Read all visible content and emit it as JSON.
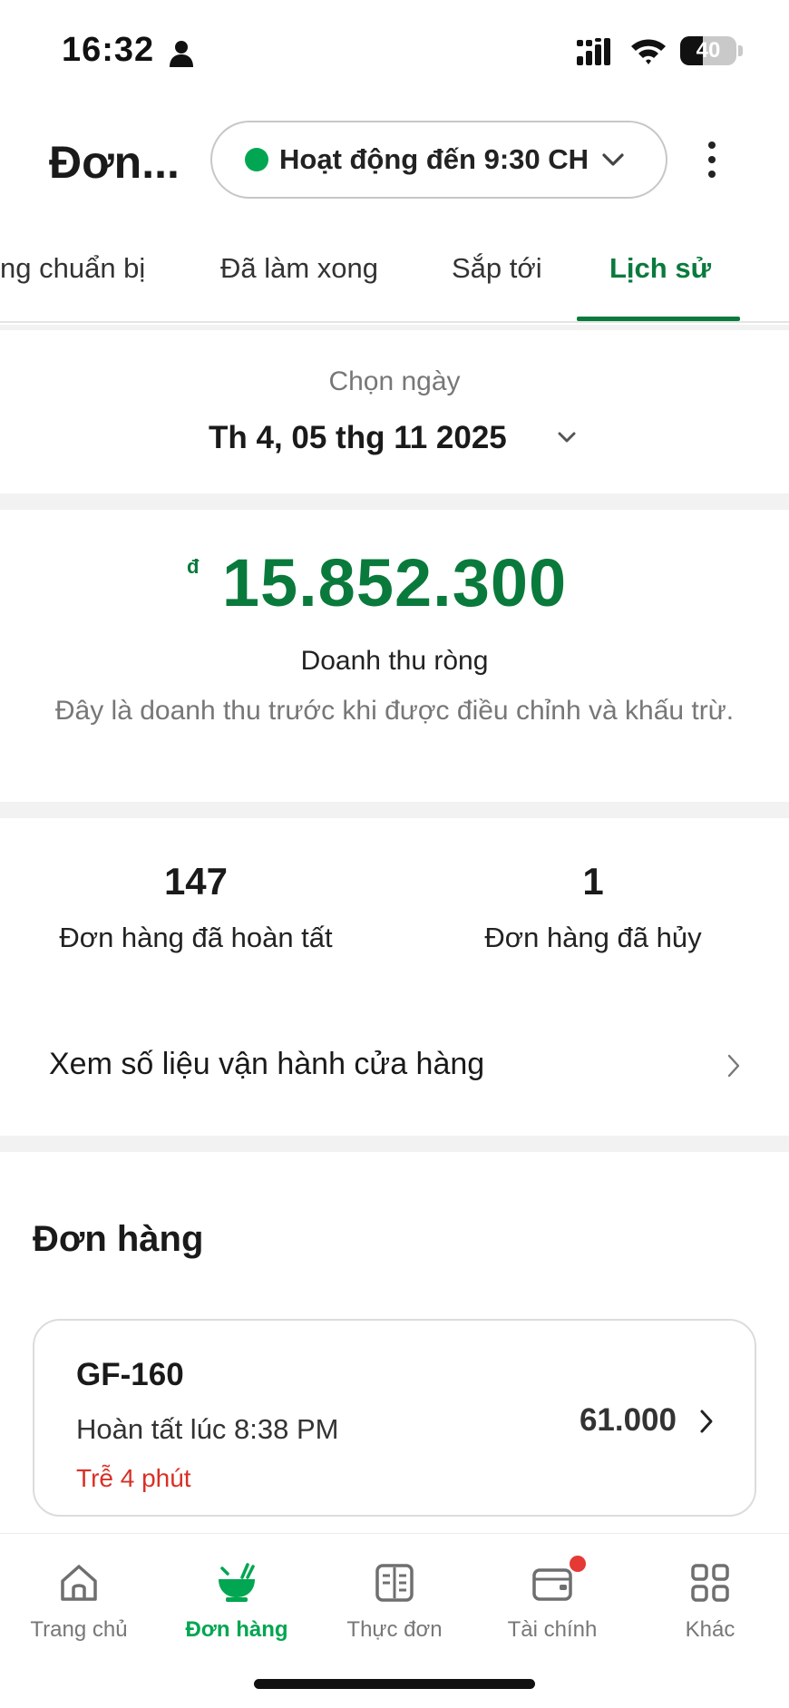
{
  "status_bar": {
    "time": "16:32",
    "battery_level": "40",
    "icons": [
      "person-icon",
      "signal-icon",
      "wifi-icon",
      "battery-icon"
    ]
  },
  "header": {
    "title": "Đơn...",
    "status_text": "Hoạt động đến 9:30 CH",
    "status_color": "#00a651"
  },
  "tabs": [
    {
      "label": "ng chuẩn bị",
      "active": false
    },
    {
      "label": "Đã làm xong",
      "active": false
    },
    {
      "label": "Sắp tới",
      "active": false
    },
    {
      "label": "Lịch sử",
      "active": true
    }
  ],
  "date_picker": {
    "label": "Chọn ngày",
    "value": "Th 4, 05 thg 11 2025"
  },
  "revenue": {
    "currency": "đ",
    "amount": "15.852.300",
    "label": "Doanh thu ròng",
    "description": "Đây là doanh thu trước khi được điều chỉnh và khấu trừ."
  },
  "stats": {
    "completed_count": "147",
    "completed_label": "Đơn hàng đã hoàn tất",
    "cancelled_count": "1",
    "cancelled_label": "Đơn hàng đã hủy"
  },
  "ops_link": {
    "label": "Xem số liệu vận hành cửa hàng"
  },
  "orders": {
    "heading": "Đơn hàng",
    "items": [
      {
        "id": "GF-160",
        "completed": "Hoàn tất lúc 8:38 PM",
        "late": "Trễ 4 phút",
        "amount": "61.000"
      }
    ]
  },
  "bottom_nav": {
    "items": [
      {
        "label": "Trang chủ",
        "icon": "home-icon",
        "active": false
      },
      {
        "label": "Đơn hàng",
        "icon": "orders-bowl-icon",
        "active": true
      },
      {
        "label": "Thực đơn",
        "icon": "menu-book-icon",
        "active": false
      },
      {
        "label": "Tài chính",
        "icon": "wallet-icon",
        "active": false,
        "badge": true
      },
      {
        "label": "Khác",
        "icon": "grid-icon",
        "active": false
      }
    ]
  },
  "colors": {
    "brand_green": "#0a7a3c",
    "active_green": "#00a651",
    "late_red": "#d93025",
    "badge_red": "#e53935"
  }
}
